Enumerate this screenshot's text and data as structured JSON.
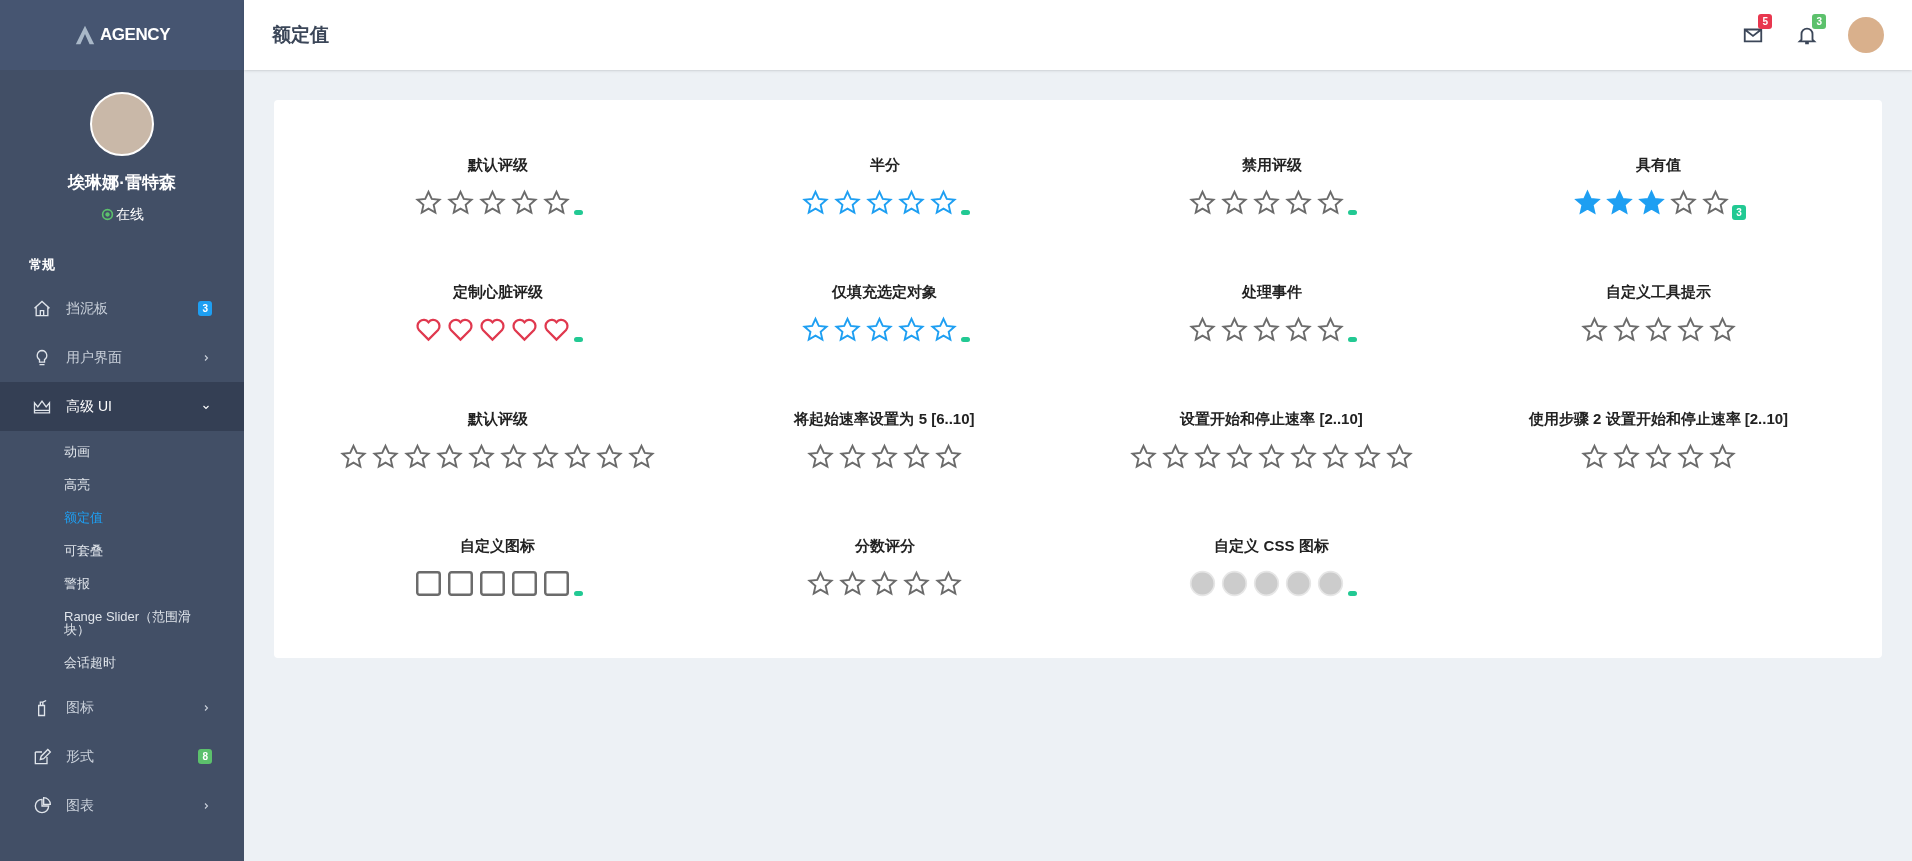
{
  "sidebar": {
    "logo": "AGENCY",
    "user": {
      "name": "埃琳娜·雷特森",
      "status": "在线"
    },
    "section": "常规",
    "items": [
      {
        "label": "挡泥板",
        "kind": "badge",
        "badge": "3",
        "color": "#1e9ff2",
        "selected": false
      },
      {
        "label": "用户界面",
        "kind": "submenu",
        "expanded": false,
        "selected": false
      },
      {
        "label": "高级 UI",
        "kind": "submenu",
        "expanded": true,
        "selected": true,
        "children": [
          {
            "label": "动画",
            "selected": false
          },
          {
            "label": "高亮",
            "selected": false
          },
          {
            "label": "额定值",
            "selected": true
          },
          {
            "label": "可套叠",
            "selected": false
          },
          {
            "label": "警报",
            "selected": false
          },
          {
            "label": "Range Slider（范围滑块）",
            "selected": false
          },
          {
            "label": "会话超时",
            "selected": false
          }
        ]
      },
      {
        "label": "图标",
        "kind": "submenu",
        "expanded": false,
        "selected": false
      },
      {
        "label": "形式",
        "kind": "badge",
        "badge": "8",
        "color": "#5cc16c",
        "selected": false
      },
      {
        "label": "图表",
        "kind": "submenu",
        "expanded": false,
        "selected": false
      }
    ]
  },
  "header": {
    "title": "额定值",
    "mail_badge": "5",
    "notification_badge": "3"
  },
  "ratings": [
    {
      "title": "默认评级",
      "kind": "star",
      "stars": 0,
      "badge": true,
      "icons": [
        {
          "color": "#6b6b6b"
        },
        {
          "color": "#6b6b6b"
        },
        {
          "color": "#6b6b6b"
        },
        {
          "color": "#6b6b6b"
        },
        {
          "color": "#6b6b6b"
        }
      ]
    },
    {
      "title": "半分",
      "kind": "star",
      "stars": 0,
      "badge": true,
      "icons": [
        {
          "color": "#1e9ff2"
        },
        {
          "color": "#1e9ff2"
        },
        {
          "color": "#1e9ff2"
        },
        {
          "color": "#1e9ff2"
        },
        {
          "color": "#1e9ff2"
        }
      ]
    },
    {
      "title": "禁用评级",
      "kind": "star",
      "stars": 0,
      "badge": true,
      "icons": [
        {
          "color": "#6b6b6b"
        },
        {
          "color": "#6b6b6b"
        },
        {
          "color": "#6b6b6b"
        },
        {
          "color": "#6b6b6b"
        },
        {
          "color": "#6b6b6b"
        }
      ]
    },
    {
      "title": "具有值",
      "kind": "star",
      "stars": 3,
      "badge": true,
      "value_label": "3",
      "icons": [
        {
          "color": "#1e9ff2"
        },
        {
          "color": "#1e9ff2"
        },
        {
          "color": "#1e9ff2"
        },
        {
          "color": "#6b6b6b"
        },
        {
          "color": "#6b6b6b"
        }
      ]
    },
    {
      "title": "定制心脏评级",
      "kind": "heart",
      "stars": 0,
      "badge": true,
      "icons": [
        {
          "color": "#e0384e"
        },
        {
          "color": "#e0384e"
        },
        {
          "color": "#e0384e"
        },
        {
          "color": "#e0384e"
        },
        {
          "color": "#e0384e"
        }
      ]
    },
    {
      "title": "仅填充选定对象",
      "kind": "star",
      "stars": 0,
      "badge": true,
      "icons": [
        {
          "color": "#1e9ff2"
        },
        {
          "color": "#1e9ff2"
        },
        {
          "color": "#1e9ff2"
        },
        {
          "color": "#1e9ff2"
        },
        {
          "color": "#1e9ff2"
        }
      ]
    },
    {
      "title": "处理事件",
      "kind": "star",
      "stars": 0,
      "badge": true,
      "icons": [
        {
          "color": "#6b6b6b"
        },
        {
          "color": "#6b6b6b"
        },
        {
          "color": "#6b6b6b"
        },
        {
          "color": "#6b6b6b"
        },
        {
          "color": "#6b6b6b"
        }
      ]
    },
    {
      "title": "自定义工具提示",
      "kind": "star",
      "stars": 0,
      "badge": false,
      "icons": [
        {
          "color": "#6b6b6b"
        },
        {
          "color": "#6b6b6b"
        },
        {
          "color": "#6b6b6b"
        },
        {
          "color": "#6b6b6b"
        },
        {
          "color": "#6b6b6b"
        }
      ]
    },
    {
      "title": "默认评级",
      "kind": "star",
      "stars": 0,
      "badge": false,
      "icons": [
        {
          "color": "#6b6b6b"
        },
        {
          "color": "#6b6b6b"
        },
        {
          "color": "#6b6b6b"
        },
        {
          "color": "#6b6b6b"
        },
        {
          "color": "#6b6b6b"
        },
        {
          "color": "#6b6b6b"
        },
        {
          "color": "#6b6b6b"
        },
        {
          "color": "#6b6b6b"
        },
        {
          "color": "#6b6b6b"
        },
        {
          "color": "#6b6b6b"
        }
      ]
    },
    {
      "title": "将起始速率设置为 5 [6..10]",
      "kind": "star",
      "stars": 0,
      "badge": false,
      "icons": [
        {
          "color": "#6b6b6b"
        },
        {
          "color": "#6b6b6b"
        },
        {
          "color": "#6b6b6b"
        },
        {
          "color": "#6b6b6b"
        },
        {
          "color": "#6b6b6b"
        }
      ]
    },
    {
      "title": "设置开始和停止速率 [2..10]",
      "kind": "star",
      "stars": 0,
      "badge": false,
      "icons": [
        {
          "color": "#6b6b6b"
        },
        {
          "color": "#6b6b6b"
        },
        {
          "color": "#6b6b6b"
        },
        {
          "color": "#6b6b6b"
        },
        {
          "color": "#6b6b6b"
        },
        {
          "color": "#6b6b6b"
        },
        {
          "color": "#6b6b6b"
        },
        {
          "color": "#6b6b6b"
        },
        {
          "color": "#6b6b6b"
        }
      ]
    },
    {
      "title": "使用步骤 2 设置开始和停止速率 [2..10]",
      "kind": "star",
      "stars": 0,
      "badge": false,
      "icons": [
        {
          "color": "#6b6b6b"
        },
        {
          "color": "#6b6b6b"
        },
        {
          "color": "#6b6b6b"
        },
        {
          "color": "#6b6b6b"
        },
        {
          "color": "#6b6b6b"
        }
      ]
    },
    {
      "title": "自定义图标",
      "kind": "square",
      "stars": 0,
      "badge": true,
      "icons": [
        {
          "color": "#6b6b6b"
        },
        {
          "color": "#6b6b6b"
        },
        {
          "color": "#6b6b6b"
        },
        {
          "color": "#6b6b6b"
        },
        {
          "color": "#6b6b6b"
        }
      ]
    },
    {
      "title": "分数评分",
      "kind": "star",
      "stars": 0,
      "badge": false,
      "icons": [
        {
          "color": "#6b6b6b"
        },
        {
          "color": "#6b6b6b"
        },
        {
          "color": "#6b6b6b"
        },
        {
          "color": "#6b6b6b"
        },
        {
          "color": "#6b6b6b"
        }
      ]
    },
    {
      "title": "自定义 CSS 图标",
      "kind": "circle",
      "stars": 0,
      "badge": true,
      "icons": [
        {
          "color": "#cccccc"
        },
        {
          "color": "#cccccc"
        },
        {
          "color": "#cccccc"
        },
        {
          "color": "#cccccc"
        },
        {
          "color": "#cccccc"
        }
      ]
    }
  ]
}
